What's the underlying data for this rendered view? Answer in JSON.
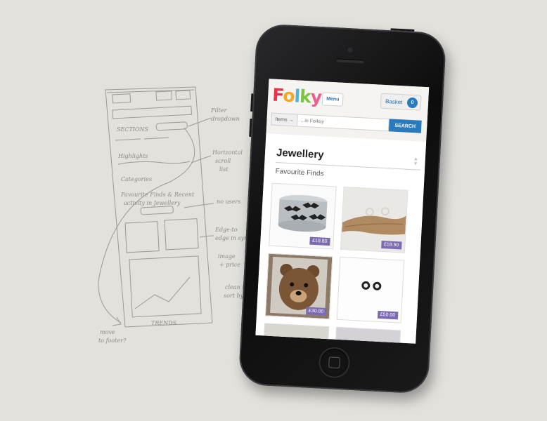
{
  "sketch_notes": {
    "sections": "SECTIONS",
    "highlights": "Highlights",
    "categories": "Categories",
    "favourite": "Favourite Finds & Recent",
    "activity": "activity in Jewellery",
    "filter": "Filter",
    "dropdown": "dropdown",
    "horizontal": "Horizontal",
    "scroll": "scroll",
    "list": "list",
    "no_users": "no users",
    "edge": "Edge-to",
    "edge2": "edge in sync",
    "image_price": "image",
    "image_price2": "+ price",
    "clean_up": "clean up",
    "sort": "sort by...",
    "move": "move",
    "to_footer": "to footer?",
    "trends": "TRENDS"
  },
  "app": {
    "logo_letters": [
      "F",
      "o",
      "l",
      "k",
      "y"
    ],
    "menu_label": "Menu",
    "basket_label": "Basket",
    "basket_count": "0"
  },
  "search": {
    "scope_label": "Items →",
    "placeholder": "...in Folksy",
    "button_label": "SEARCH"
  },
  "category": {
    "title": "Jewellery",
    "section_title": "Favourite Finds"
  },
  "products": [
    {
      "price": "£19.80",
      "image": "bat-cuff-bracelet"
    },
    {
      "price": "£18.50",
      "image": "driftwood-earrings"
    },
    {
      "price": "£30.00",
      "image": "bear-brooch"
    },
    {
      "price": "£50.00",
      "image": "stud-earrings"
    }
  ],
  "colors": {
    "search_button": "#2a7bbd",
    "price_badge": "#7c6bb0",
    "link": "#2a6ea6"
  }
}
